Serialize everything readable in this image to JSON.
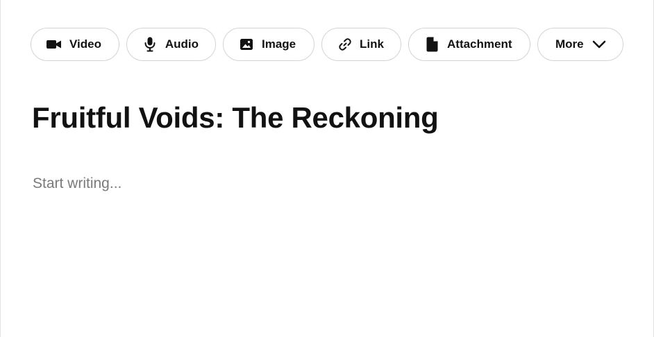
{
  "toolbar": {
    "buttons": [
      {
        "label": "Video",
        "icon": "video-camera-icon"
      },
      {
        "label": "Audio",
        "icon": "microphone-icon"
      },
      {
        "label": "Image",
        "icon": "image-icon"
      },
      {
        "label": "Link",
        "icon": "link-icon"
      },
      {
        "label": "Attachment",
        "icon": "file-icon"
      },
      {
        "label": "More",
        "icon": "chevron-down-icon"
      }
    ]
  },
  "post": {
    "title": "Fruitful Voids: The Reckoning",
    "body_value": "",
    "body_placeholder": "Start writing..."
  },
  "colors": {
    "text": "#121212",
    "border": "#d3d3d3",
    "placeholder": "#7a7a7a",
    "background": "#ffffff"
  }
}
